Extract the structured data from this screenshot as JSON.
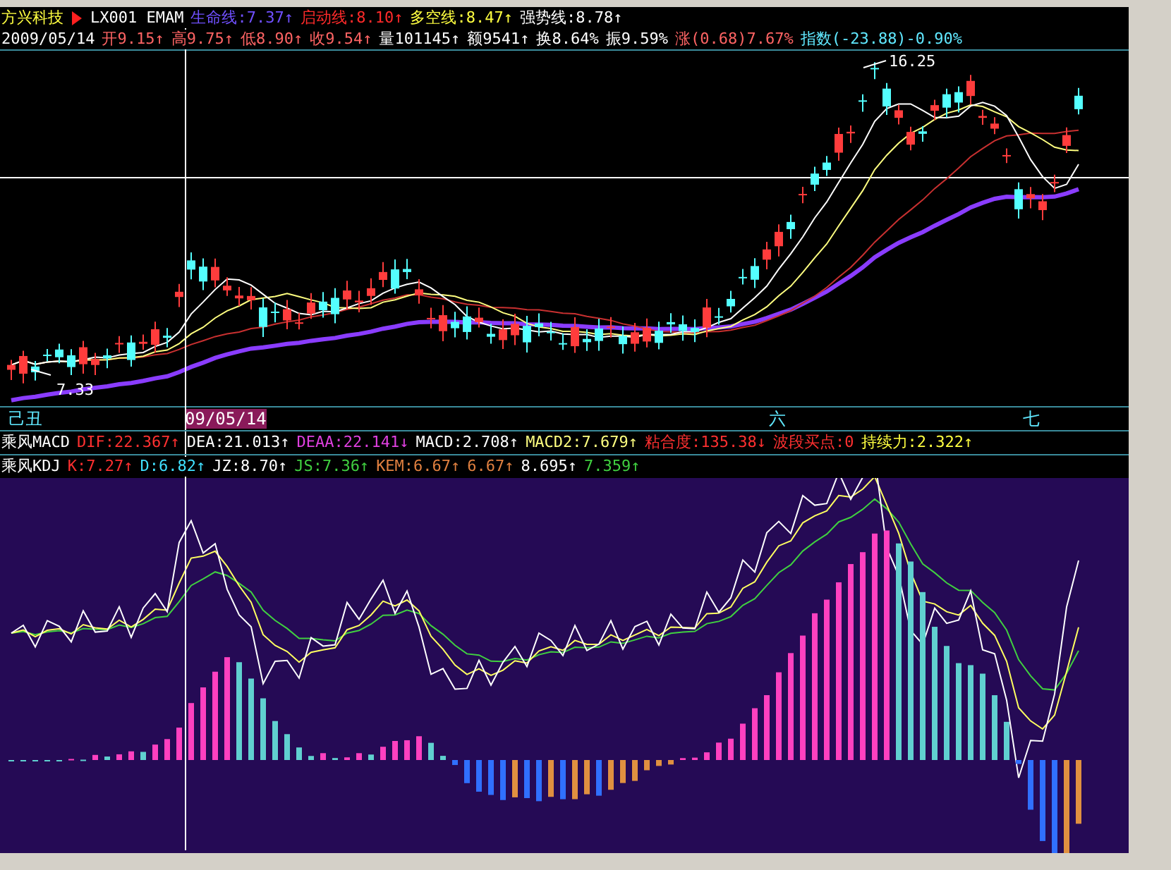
{
  "header": {
    "stock_name": "方兴科技",
    "formula": "LX001 EMAM",
    "lines": [
      {
        "text": "生命线:7.37↑",
        "color": "#7050ff"
      },
      {
        "text": "启动线:8.10↑",
        "color": "#ff2a2a"
      },
      {
        "text": "多空线:8.47↑",
        "color": "#ffff40"
      },
      {
        "text": "强势线:8.78↑",
        "color": "#ffffff"
      }
    ]
  },
  "quote": {
    "date": "2009/05/14",
    "fields": [
      {
        "text": "开9.15↑",
        "color": "#ff6464"
      },
      {
        "text": "高9.75↑",
        "color": "#ff6464"
      },
      {
        "text": "低8.90↑",
        "color": "#ff6464"
      },
      {
        "text": "收9.54↑",
        "color": "#ff6464"
      },
      {
        "text": "量101145↑",
        "color": "#ffffff"
      },
      {
        "text": "额9541↑",
        "color": "#ffffff"
      },
      {
        "text": "换8.64%",
        "color": "#ffffff"
      },
      {
        "text": "振9.59%",
        "color": "#ffffff"
      },
      {
        "text": "涨(0.68)7.67%",
        "color": "#ff6464"
      },
      {
        "text": "指数(-23.88)-0.90%",
        "color": "#60e8ff"
      }
    ]
  },
  "price_chart": {
    "high_label": "16.25",
    "low_label": "7.33"
  },
  "time_axis": [
    {
      "text": "己丑",
      "kind": "period"
    },
    {
      "text": "09/05/14",
      "kind": "cursor"
    },
    {
      "text": "六",
      "kind": "period"
    },
    {
      "text": "七",
      "kind": "period"
    }
  ],
  "macd_line": {
    "title": "乘风MACD",
    "values": [
      {
        "text": "DIF:22.367↑",
        "color": "#ff3030"
      },
      {
        "text": "DEA:21.013↑",
        "color": "#ffffff"
      },
      {
        "text": "DEAA:22.141↓",
        "color": "#e040e0"
      },
      {
        "text": "MACD:2.708↑",
        "color": "#ffffff"
      },
      {
        "text": "MACD2:7.679↑",
        "color": "#ffff80"
      },
      {
        "text": "粘合度:135.38↓",
        "color": "#ff3030"
      },
      {
        "text": "波段买点:0",
        "color": "#ff3030"
      },
      {
        "text": "持续力:2.322↑",
        "color": "#ffff40"
      }
    ]
  },
  "kdj_line": {
    "title": "乘风KDJ",
    "values": [
      {
        "text": "K:7.27↑",
        "color": "#ff3030"
      },
      {
        "text": "D:6.82↑",
        "color": "#40e0ff"
      },
      {
        "text": "JZ:8.70↑",
        "color": "#ffffff"
      },
      {
        "text": "JS:7.36↑",
        "color": "#40d040"
      },
      {
        "text": "KEM:6.67↑",
        "color": "#e08040"
      },
      {
        "text": "6.67↑",
        "color": "#e08040"
      },
      {
        "text": "8.695↑",
        "color": "#ffffff"
      },
      {
        "text": "7.359↑",
        "color": "#40d040"
      }
    ]
  }
}
